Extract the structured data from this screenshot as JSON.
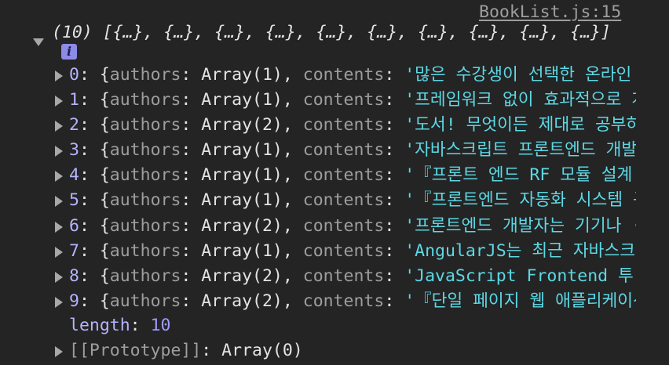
{
  "source_link": "BookList.js:15",
  "summary": "(10) [{…}, {…}, {…}, {…}, {…}, {…}, {…}, {…}, {…}, {…}]",
  "info_icon": "i",
  "items": [
    {
      "index": "0",
      "authors_key": "authors",
      "authors_val": "Array(1)",
      "contents_key": "contents",
      "contents_val": "'많은 수강생이 선택한 온라인"
    },
    {
      "index": "1",
      "authors_key": "authors",
      "authors_val": "Array(1)",
      "contents_key": "contents",
      "contents_val": "'프레임워크 없이 효과적으로 개"
    },
    {
      "index": "2",
      "authors_key": "authors",
      "authors_val": "Array(2)",
      "contents_key": "contents",
      "contents_val": "'도서! 무엇이든 제대로 공부하"
    },
    {
      "index": "3",
      "authors_key": "authors",
      "authors_val": "Array(1)",
      "contents_key": "contents",
      "contents_val": "'자바스크립트 프론트엔드 개발"
    },
    {
      "index": "4",
      "authors_key": "authors",
      "authors_val": "Array(1)",
      "contents_key": "contents",
      "contents_val": "'『프론트 엔드 RF 모듈 설계"
    },
    {
      "index": "5",
      "authors_key": "authors",
      "authors_val": "Array(1)",
      "contents_key": "contents",
      "contents_val": "'『프론트엔드 자동화 시스템 구"
    },
    {
      "index": "6",
      "authors_key": "authors",
      "authors_val": "Array(2)",
      "contents_key": "contents",
      "contents_val": "'프론트엔드 개발자는 기기나 ·"
    },
    {
      "index": "7",
      "authors_key": "authors",
      "authors_val": "Array(1)",
      "contents_key": "contents",
      "contents_val": "'AngularJS는 최근 자바스크"
    },
    {
      "index": "8",
      "authors_key": "authors",
      "authors_val": "Array(2)",
      "contents_key": "contents",
      "contents_val": "'JavaScript Frontend 투"
    },
    {
      "index": "9",
      "authors_key": "authors",
      "authors_val": "Array(2)",
      "contents_key": "contents",
      "contents_val": "'『단일 페이지 웹 애플리케이션"
    }
  ],
  "length_key": "length",
  "length_val": "10",
  "prototype_key": "[[Prototype]]",
  "prototype_val": "Array(0)"
}
